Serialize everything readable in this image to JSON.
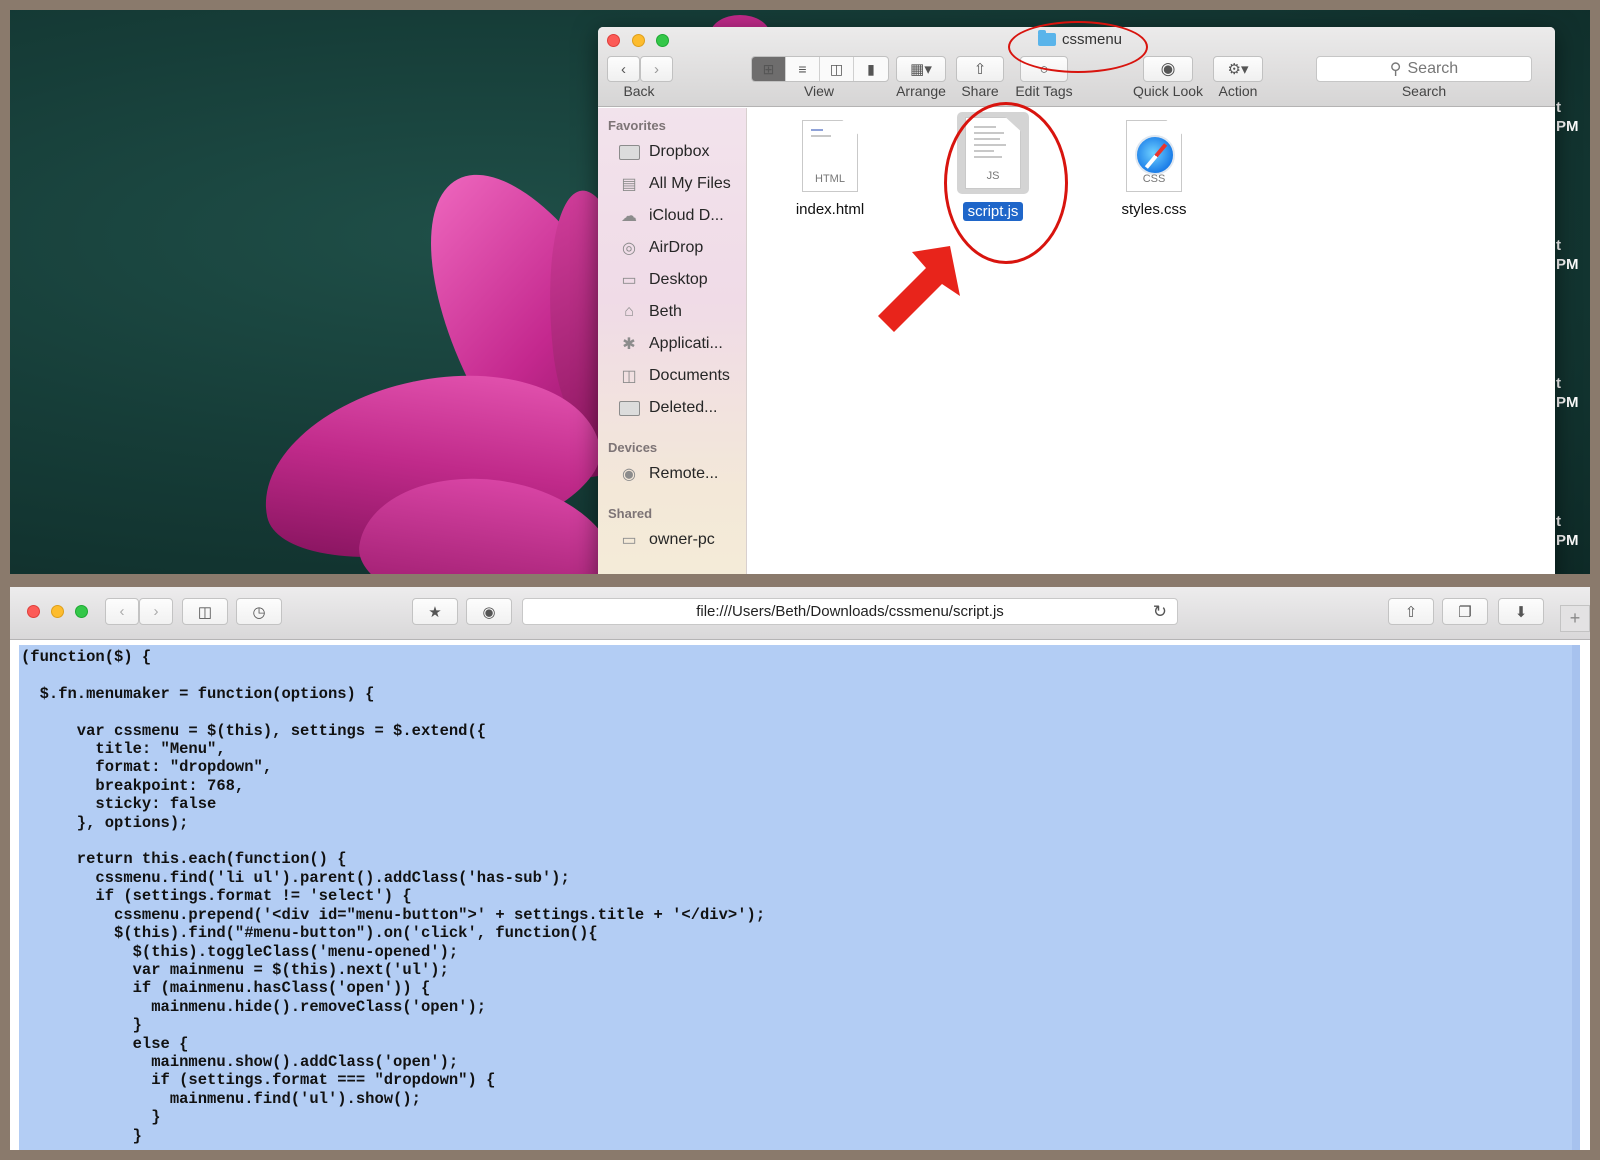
{
  "finder": {
    "title": "cssmenu",
    "toolbar": {
      "back_label": "Back",
      "view_label": "View",
      "arrange_label": "Arrange",
      "share_label": "Share",
      "edit_tags_label": "Edit Tags",
      "quick_look_label": "Quick Look",
      "action_label": "Action",
      "search_placeholder": "Search",
      "search_label": "Search"
    },
    "sidebar": {
      "favorites_heading": "Favorites",
      "favorites": [
        "Dropbox",
        "All My Files",
        "iCloud D...",
        "AirDrop",
        "Desktop",
        "Beth",
        "Applicati...",
        "Documents",
        "Deleted..."
      ],
      "devices_heading": "Devices",
      "devices": [
        "Remote..."
      ],
      "shared_heading": "Shared",
      "shared": [
        "owner-pc"
      ]
    },
    "files": [
      {
        "name": "index.html",
        "ext": "HTML",
        "selected": false
      },
      {
        "name": "script.js",
        "ext": "JS",
        "selected": true
      },
      {
        "name": "styles.css",
        "ext": "CSS",
        "selected": false
      }
    ]
  },
  "desktop": {
    "clock_fragments": [
      {
        "line1": "t",
        "line2": "PM"
      },
      {
        "line1": "t",
        "line2": "PM"
      },
      {
        "line1": "t",
        "line2": "PM"
      },
      {
        "line1": "t",
        "line2": "PM"
      }
    ]
  },
  "browser": {
    "url": "file:///Users/Beth/Downloads/cssmenu/script.js",
    "code": "(function($) {\n\n  $.fn.menumaker = function(options) {\n\n      var cssmenu = $(this), settings = $.extend({\n        title: \"Menu\",\n        format: \"dropdown\",\n        breakpoint: 768,\n        sticky: false\n      }, options);\n\n      return this.each(function() {\n        cssmenu.find('li ul').parent().addClass('has-sub');\n        if (settings.format != 'select') {\n          cssmenu.prepend('<div id=\"menu-button\">' + settings.title + '</div>');\n          $(this).find(\"#menu-button\").on('click', function(){\n            $(this).toggleClass('menu-opened');\n            var mainmenu = $(this).next('ul');\n            if (mainmenu.hasClass('open')) {\n              mainmenu.hide().removeClass('open');\n            }\n            else {\n              mainmenu.show().addClass('open');\n              if (settings.format === \"dropdown\") {\n                mainmenu.find('ul').show();\n              }\n            }"
  },
  "colors": {
    "selection_blue": "#1f66c9",
    "annotation_red": "#d8140e",
    "code_background": "#b3cdf4"
  }
}
